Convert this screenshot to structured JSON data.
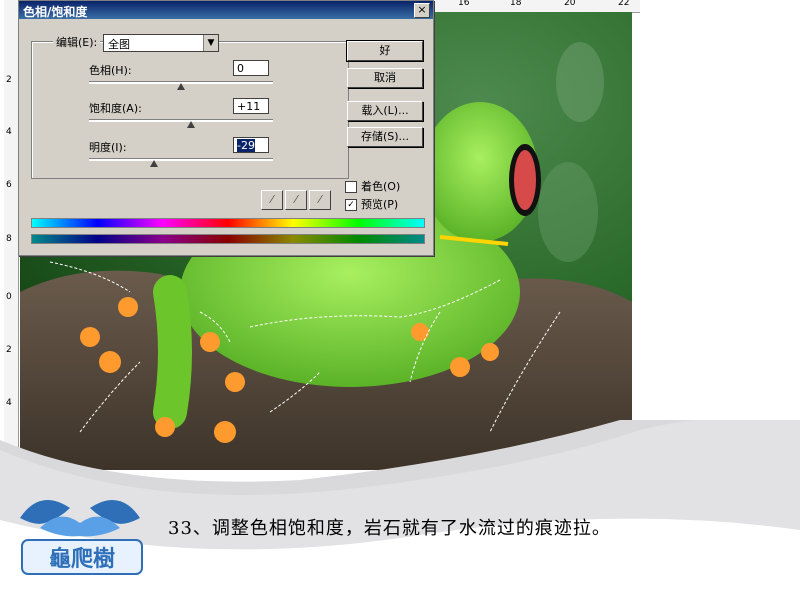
{
  "dialog": {
    "title": "色相/饱和度",
    "close": "×",
    "edit_label": "编辑(E):",
    "edit_value": "全图",
    "hue_label": "色相(H):",
    "hue_value": "0",
    "hue_level": 0.5,
    "sat_label": "饱和度(A):",
    "sat_value": "+11",
    "sat_level": 0.555,
    "light_label": "明度(I):",
    "light_value": "-29",
    "light_level": 0.355,
    "buttons": {
      "ok": "好",
      "cancel": "取消",
      "load": "载入(L)...",
      "save": "存储(S)..."
    },
    "colorize_label": "着色(O)",
    "colorize_checked": false,
    "preview_label": "预览(P)",
    "preview_checked": true,
    "eyedropper_icons": [
      "eyedropper-icon",
      "eyedropper-plus-icon",
      "eyedropper-minus-icon"
    ]
  },
  "ruler": {
    "top_numbers": [
      "16",
      "18",
      "20",
      "22"
    ],
    "left_numbers": [
      "2",
      "4",
      "6",
      "8",
      "0",
      "2",
      "4"
    ]
  },
  "caption": "33、调整色相饱和度，岩石就有了水流过的痕迹拉。",
  "logo_text": "龜爬樹",
  "colors": {
    "title_bar": "#0a246a",
    "dialog_bg": "#d4d0c8",
    "banner": "#d9d9db",
    "leaf_green": "#1f5a1f",
    "frog_green": "#7ccf2c",
    "toe_orange": "#ff9a2e",
    "logo_blue": "#2e6fb8"
  }
}
